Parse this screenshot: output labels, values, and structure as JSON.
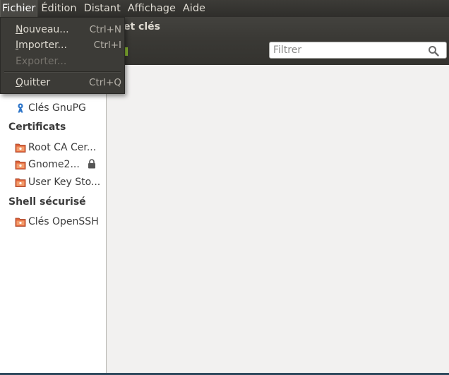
{
  "menubar": {
    "items": [
      "Fichier",
      "Édition",
      "Distant",
      "Affichage",
      "Aide"
    ]
  },
  "window": {
    "title_fragment": "et clés"
  },
  "search": {
    "placeholder": "Filtrer",
    "value": ""
  },
  "file_menu": {
    "items": [
      {
        "mnemonic": "N",
        "rest": "ouveau...",
        "shortcut": "Ctrl+N",
        "enabled": true
      },
      {
        "mnemonic": "I",
        "rest": "mporter...",
        "shortcut": "Ctrl+I",
        "enabled": true
      },
      {
        "label": "Exporter...",
        "shortcut": "",
        "enabled": false
      },
      {
        "mnemonic": "Q",
        "rest": "uitter",
        "shortcut": "Ctrl+Q",
        "enabled": true
      }
    ]
  },
  "sidebar": {
    "items": [
      {
        "label": "Clés GnuPG",
        "icon": "gnupg-key-icon"
      }
    ],
    "groups": [
      {
        "header": "Certificats",
        "items": [
          {
            "label": "Root CA Cer...",
            "icon": "keyring-folder-icon"
          },
          {
            "label": "Gnome2...",
            "icon": "keyring-folder-icon",
            "locked": true
          },
          {
            "label": "User Key Sto...",
            "icon": "keyring-folder-icon"
          }
        ]
      },
      {
        "header": "Shell sécurisé",
        "items": [
          {
            "label": "Clés OpenSSH",
            "icon": "keyring-folder-icon"
          }
        ]
      }
    ]
  },
  "colors": {
    "menubar": "#3c3b37",
    "accent_green": "#8ab833",
    "folder_orange": "#e0633a"
  }
}
